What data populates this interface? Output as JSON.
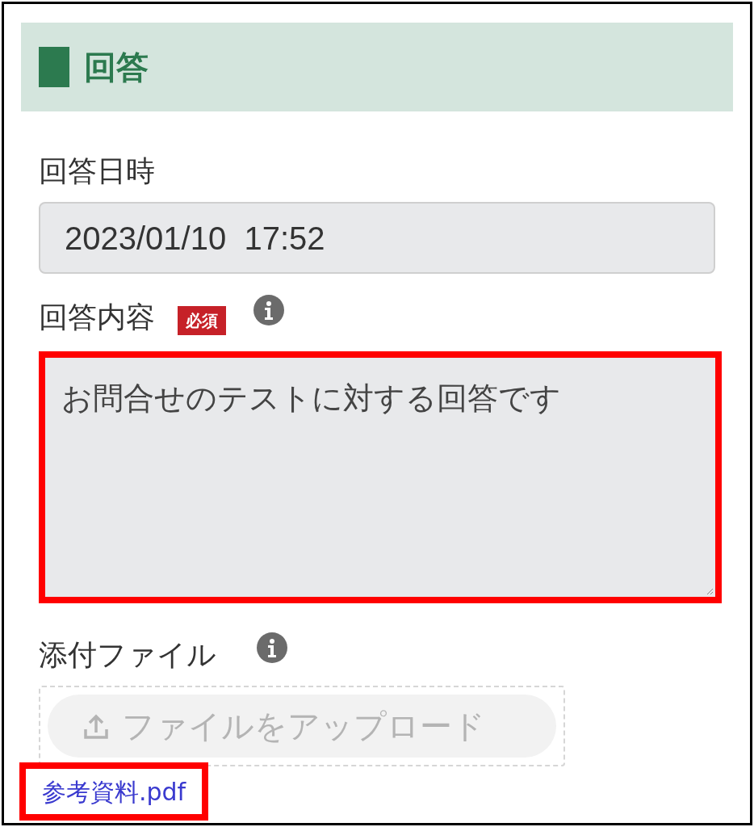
{
  "section": {
    "title": "回答"
  },
  "fields": [
    {
      "kind": "text",
      "label": "回答日時",
      "value": "2023/01/10  17:52",
      "required": false,
      "info": false
    },
    {
      "kind": "textarea",
      "label": "回答内容",
      "required_badge": "必須",
      "required": true,
      "info": true,
      "value": "お問合せのテストに対する回答です",
      "highlighted": true
    },
    {
      "kind": "upload",
      "label": "添付ファイル",
      "required": false,
      "info": true,
      "button": "ファイルをアップロード",
      "disabled": true,
      "files": [
        {
          "name": "参考資料.pdf",
          "highlighted": true
        }
      ]
    }
  ]
}
